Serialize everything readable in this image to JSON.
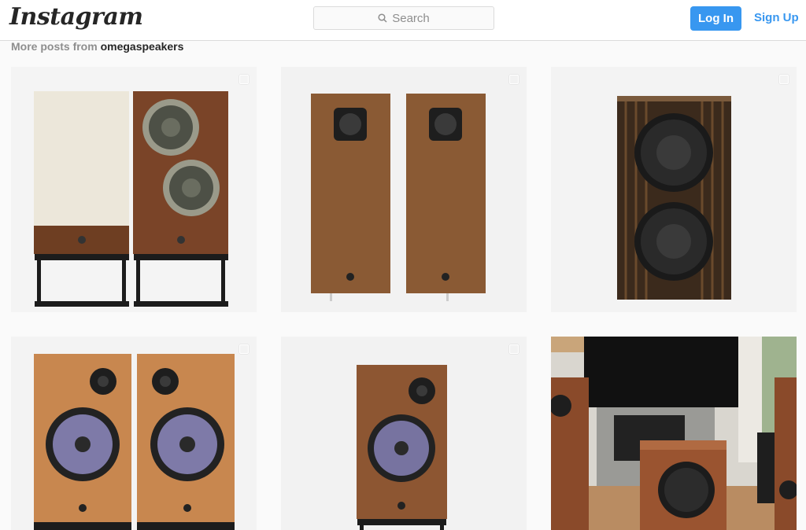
{
  "header": {
    "logo": "Instagram",
    "search_placeholder": "Search",
    "login_label": "Log In",
    "signup_label": "Sign Up"
  },
  "section": {
    "prefix": "More posts from ",
    "username": "omegaspeakers"
  },
  "posts": [
    {
      "description": "speakers-with-stands"
    },
    {
      "description": "twin-walnut-speakers"
    },
    {
      "description": "striped-subwoofer"
    },
    {
      "description": "cherry-bookshelf-pair"
    },
    {
      "description": "single-walnut-speaker"
    },
    {
      "description": "living-room-setup"
    }
  ],
  "colors": {
    "accent": "#3897f0",
    "bar_border": "#dbdbdb"
  }
}
